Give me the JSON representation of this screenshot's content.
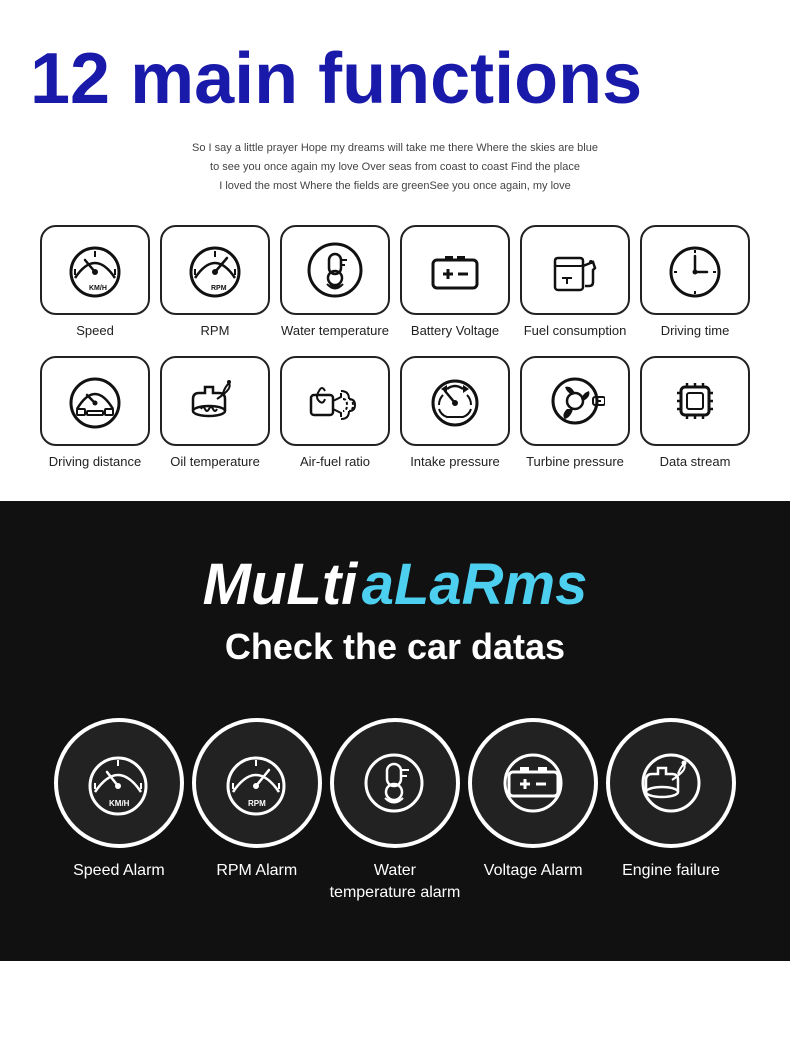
{
  "top": {
    "title": "12 main functions",
    "subtitle_lines": [
      "So I say a little prayer Hope my dreams will take me there Where the skies are blue",
      "to see you once again my love Over seas from coast to coast Find the place",
      "I loved the most Where the fields are greenSee you once again, my love"
    ]
  },
  "functions": [
    {
      "id": "speed",
      "label": "Speed"
    },
    {
      "id": "rpm",
      "label": "RPM"
    },
    {
      "id": "water-temp",
      "label": "Water temperature"
    },
    {
      "id": "battery",
      "label": "Battery Voltage"
    },
    {
      "id": "fuel",
      "label": "Fuel consumption"
    },
    {
      "id": "driving-time",
      "label": "Driving time"
    },
    {
      "id": "driving-dist",
      "label": "Driving distance"
    },
    {
      "id": "oil-temp",
      "label": "Oil temperature"
    },
    {
      "id": "air-fuel",
      "label": "Air-fuel ratio"
    },
    {
      "id": "intake",
      "label": "Intake pressure"
    },
    {
      "id": "turbine",
      "label": "Turbine pressure"
    },
    {
      "id": "data-stream",
      "label": "Data stream"
    }
  ],
  "bottom": {
    "multi_text": "MuLti",
    "alarms_text": "aLaRms",
    "check_text": "Check the car datas"
  },
  "alarms": [
    {
      "id": "speed-alarm",
      "label": "Speed Alarm"
    },
    {
      "id": "rpm-alarm",
      "label": "RPM Alarm"
    },
    {
      "id": "water-temp-alarm",
      "label": "Water\ntemperature alarm"
    },
    {
      "id": "voltage-alarm",
      "label": "Voltage Alarm"
    },
    {
      "id": "engine-failure",
      "label": "Engine failure"
    }
  ]
}
